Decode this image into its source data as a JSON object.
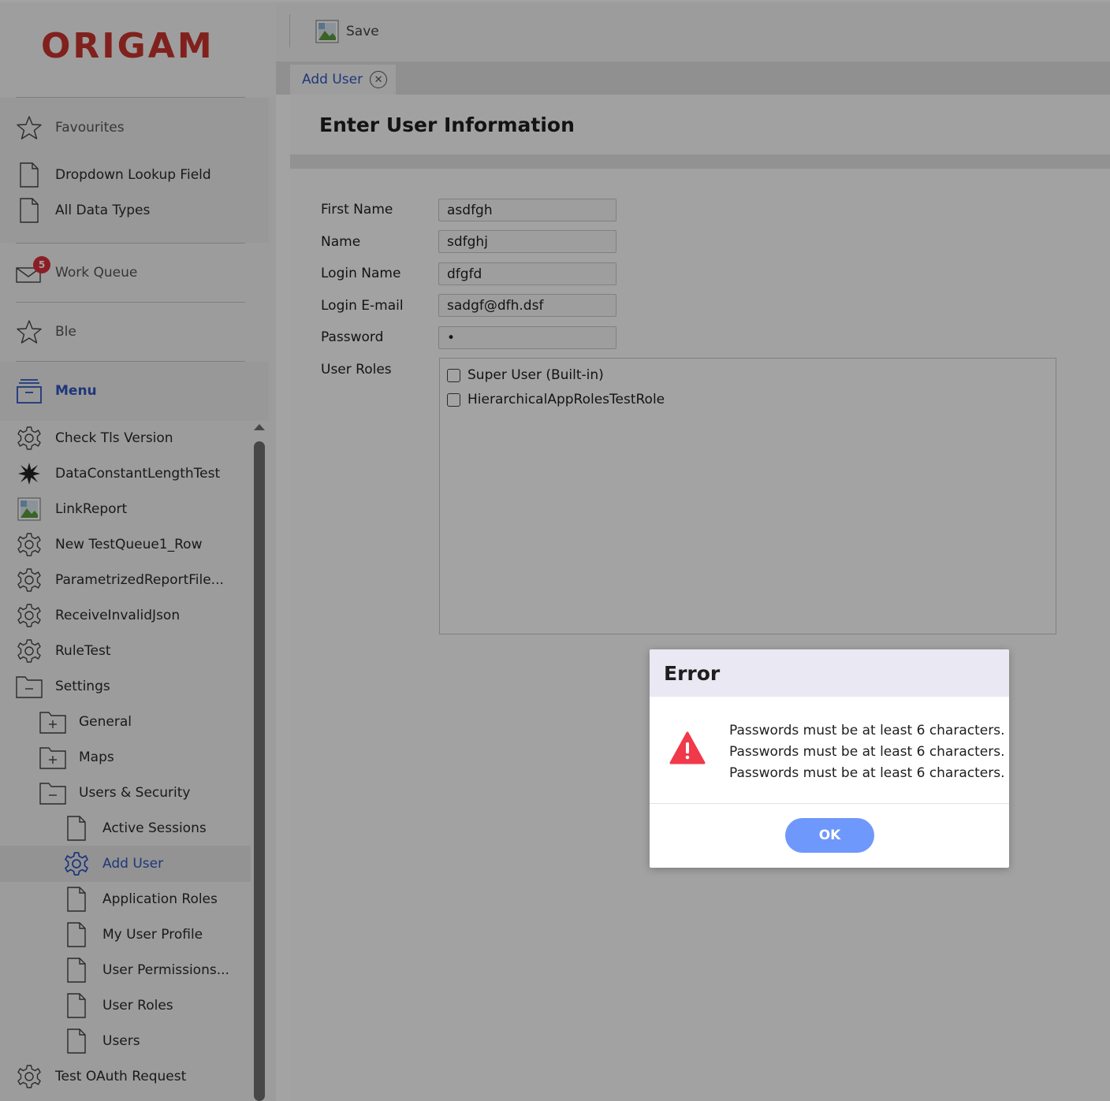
{
  "app": {
    "logo_text": "ORIGAM"
  },
  "toolbar": {
    "save_label": "Save"
  },
  "tabs": [
    {
      "label": "Add User",
      "close_glyph": "✕"
    }
  ],
  "page": {
    "title": "Enter User Information"
  },
  "sidebar": {
    "favourites": {
      "label": "Favourites",
      "items": [
        {
          "label": "Dropdown Lookup Field",
          "icon": "document-icon"
        },
        {
          "label": "All Data Types",
          "icon": "document-icon"
        }
      ]
    },
    "work_queue": {
      "label": "Work Queue",
      "badge": "5"
    },
    "ble": {
      "label": "Ble"
    },
    "menu": {
      "label": "Menu",
      "items": [
        {
          "label": "Check Tls Version",
          "icon": "gear-icon"
        },
        {
          "label": "DataConstantLengthTest",
          "icon": "burst-icon"
        },
        {
          "label": "LinkReport",
          "icon": "image-icon"
        },
        {
          "label": "New TestQueue1_Row",
          "icon": "gear-icon"
        },
        {
          "label": "ParametrizedReportFile...",
          "icon": "gear-icon"
        },
        {
          "label": "ReceiveInvalidJson",
          "icon": "gear-icon"
        },
        {
          "label": "RuleTest",
          "icon": "gear-icon"
        },
        {
          "label": "Settings",
          "icon": "folder-open-icon"
        },
        {
          "label": "General",
          "icon": "folder-closed-icon"
        },
        {
          "label": "Maps",
          "icon": "folder-closed-icon"
        },
        {
          "label": "Users & Security",
          "icon": "folder-open-icon"
        },
        {
          "label": "Active Sessions",
          "icon": "document-icon"
        },
        {
          "label": "Add User",
          "icon": "gear-icon",
          "active": true
        },
        {
          "label": "Application Roles",
          "icon": "document-icon"
        },
        {
          "label": "My User Profile",
          "icon": "document-icon"
        },
        {
          "label": "User Permissions...",
          "icon": "document-icon"
        },
        {
          "label": "User Roles",
          "icon": "document-icon"
        },
        {
          "label": "Users",
          "icon": "document-icon"
        },
        {
          "label": "Test OAuth Request",
          "icon": "gear-icon"
        }
      ]
    }
  },
  "form": {
    "fields": [
      {
        "label": "First Name",
        "value": "asdfgh"
      },
      {
        "label": "Name",
        "value": "sdfghj"
      },
      {
        "label": "Login Name",
        "value": "dfgfd"
      },
      {
        "label": "Login E-mail",
        "value": "sadgf@dfh.dsf"
      },
      {
        "label": "Password",
        "value": "•"
      }
    ],
    "roles_label": "User Roles",
    "roles": [
      {
        "label": "Super User (Built-in)",
        "checked": false
      },
      {
        "label": "HierarchicalAppRolesTestRole",
        "checked": false
      }
    ]
  },
  "dialog": {
    "title": "Error",
    "messages": [
      "Passwords must be at least 6 characters.",
      "Passwords must be at least 6 characters.",
      "Passwords must be at least 6 characters."
    ],
    "ok_label": "OK"
  },
  "colors": {
    "logo": "#c8342f",
    "accent": "#2f56c0",
    "badge": "#d9303a",
    "warning": "#f0394a",
    "ok_button": "#6f98fc"
  }
}
